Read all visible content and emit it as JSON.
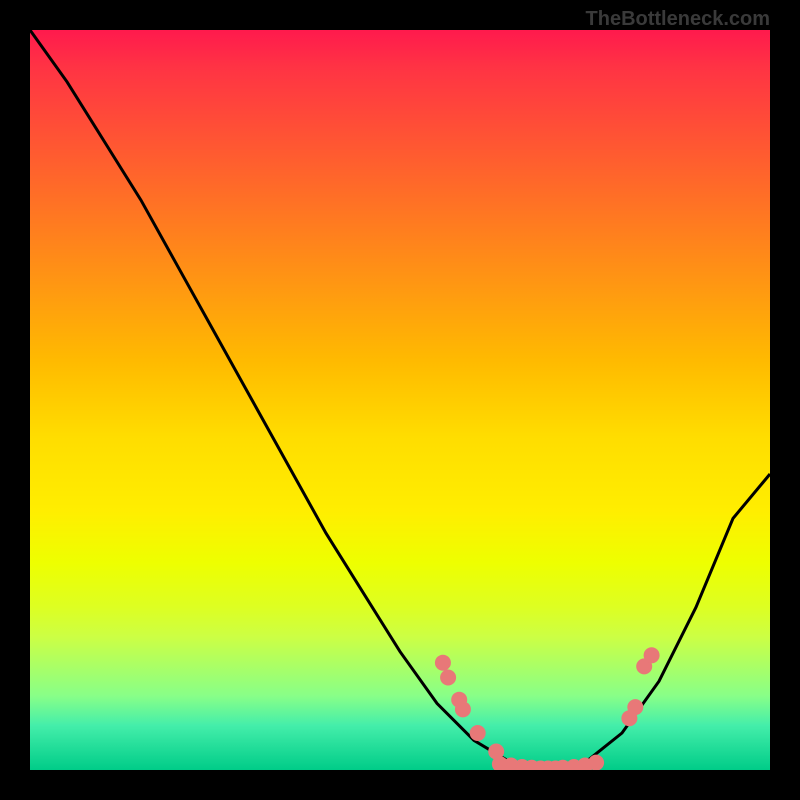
{
  "watermark": "TheBottleneck.com",
  "chart_data": {
    "type": "line",
    "title": "",
    "xlabel": "",
    "ylabel": "",
    "xlim": [
      0,
      1
    ],
    "ylim": [
      0,
      1
    ],
    "grid": false,
    "curve": {
      "name": "bottleneck-curve",
      "color": "#000000",
      "points": [
        {
          "x": 0.0,
          "y": 1.0
        },
        {
          "x": 0.05,
          "y": 0.93
        },
        {
          "x": 0.1,
          "y": 0.85
        },
        {
          "x": 0.15,
          "y": 0.77
        },
        {
          "x": 0.2,
          "y": 0.68
        },
        {
          "x": 0.25,
          "y": 0.59
        },
        {
          "x": 0.3,
          "y": 0.5
        },
        {
          "x": 0.35,
          "y": 0.41
        },
        {
          "x": 0.4,
          "y": 0.32
        },
        {
          "x": 0.45,
          "y": 0.24
        },
        {
          "x": 0.5,
          "y": 0.16
        },
        {
          "x": 0.55,
          "y": 0.09
        },
        {
          "x": 0.6,
          "y": 0.04
        },
        {
          "x": 0.65,
          "y": 0.01
        },
        {
          "x": 0.7,
          "y": 0.0
        },
        {
          "x": 0.75,
          "y": 0.01
        },
        {
          "x": 0.8,
          "y": 0.05
        },
        {
          "x": 0.85,
          "y": 0.12
        },
        {
          "x": 0.9,
          "y": 0.22
        },
        {
          "x": 0.95,
          "y": 0.34
        },
        {
          "x": 1.0,
          "y": 0.4
        }
      ]
    },
    "scatter": {
      "name": "data-points",
      "color": "#e87878",
      "radius": 8,
      "points": [
        {
          "x": 0.558,
          "y": 0.145
        },
        {
          "x": 0.565,
          "y": 0.125
        },
        {
          "x": 0.58,
          "y": 0.095
        },
        {
          "x": 0.585,
          "y": 0.082
        },
        {
          "x": 0.605,
          "y": 0.05
        },
        {
          "x": 0.63,
          "y": 0.025
        },
        {
          "x": 0.635,
          "y": 0.008
        },
        {
          "x": 0.65,
          "y": 0.006
        },
        {
          "x": 0.665,
          "y": 0.004
        },
        {
          "x": 0.678,
          "y": 0.003
        },
        {
          "x": 0.69,
          "y": 0.002
        },
        {
          "x": 0.7,
          "y": 0.002
        },
        {
          "x": 0.71,
          "y": 0.002
        },
        {
          "x": 0.72,
          "y": 0.003
        },
        {
          "x": 0.735,
          "y": 0.004
        },
        {
          "x": 0.75,
          "y": 0.006
        },
        {
          "x": 0.765,
          "y": 0.01
        },
        {
          "x": 0.81,
          "y": 0.07
        },
        {
          "x": 0.818,
          "y": 0.085
        },
        {
          "x": 0.83,
          "y": 0.14
        },
        {
          "x": 0.84,
          "y": 0.155
        }
      ]
    }
  }
}
